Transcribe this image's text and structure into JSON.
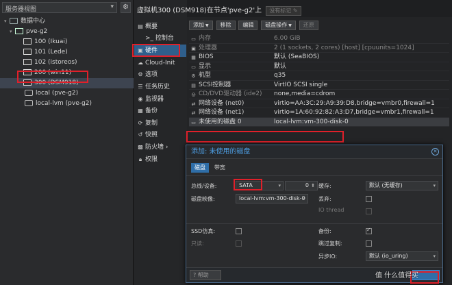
{
  "sidebar": {
    "view_label": "服务器视图",
    "tree": [
      {
        "label": "数据中心",
        "type": "datacenter"
      },
      {
        "label": "pve-g2",
        "type": "node"
      },
      {
        "label": "100 (Ikuai)",
        "type": "vm"
      },
      {
        "label": "101 (Lede)",
        "type": "vm"
      },
      {
        "label": "102 (istoreos)",
        "type": "vm"
      },
      {
        "label": "200 (win11)",
        "type": "vm"
      },
      {
        "label": "300 (DSM918)",
        "type": "vm",
        "selected": true
      },
      {
        "label": "local (pve-g2)",
        "type": "storage"
      },
      {
        "label": "local-lvm (pve-g2)",
        "type": "storage"
      }
    ]
  },
  "header": {
    "title": "虚拟机300 (DSM918)在节点'pve-g2'上",
    "tag_label": "没有标记"
  },
  "nav": {
    "items": [
      {
        "label": "概要",
        "icon": "summary-icon"
      },
      {
        "label": ">_ 控制台",
        "icon": "console-icon"
      },
      {
        "label": "硬件",
        "icon": "hardware-icon",
        "active": true
      },
      {
        "label": "Cloud-Init",
        "icon": "cloud-icon"
      },
      {
        "label": "选项",
        "icon": "options-icon"
      },
      {
        "label": "任务历史",
        "icon": "task-history-icon"
      },
      {
        "label": "监视器",
        "icon": "monitor-icon"
      },
      {
        "label": "备份",
        "icon": "backup-icon"
      },
      {
        "label": "复制",
        "icon": "replication-icon"
      },
      {
        "label": "快照",
        "icon": "snapshot-icon"
      },
      {
        "label": "防火墙",
        "icon": "firewall-icon"
      },
      {
        "label": "权限",
        "icon": "permissions-icon"
      }
    ]
  },
  "toolbar": {
    "add": "添加",
    "remove": "移除",
    "edit": "编辑",
    "disk_action": "磁盘操作",
    "revert": "还原"
  },
  "hardware": [
    {
      "name": "内存",
      "value": "6.00 GiB",
      "dim": true
    },
    {
      "name": "处理器",
      "value": "2 (1 sockets, 2 cores) [host] [cpuunits=1024]",
      "dim": true
    },
    {
      "name": "BIOS",
      "value": "默认 (SeaBIOS)"
    },
    {
      "name": "显示",
      "value": "默认"
    },
    {
      "name": "机型",
      "value": "q35"
    },
    {
      "name": "SCSI控制器",
      "value": "VirtIO SCSI single"
    },
    {
      "name": "CD/DVD驱动器 (ide2)",
      "value": "none,media=cdrom",
      "dim_name": true
    },
    {
      "name": "网络设备 (net0)",
      "value": "virtio=AA:3C:29:A9:39:D8,bridge=vmbr0,firewall=1"
    },
    {
      "name": "网络设备 (net1)",
      "value": "virtio=1A:60:92:82:A3:D7,bridge=vmbr1,firewall=1"
    },
    {
      "name": "未使用的磁盘 0",
      "value": "local-lvm:vm-300-disk-0",
      "selected": true
    }
  ],
  "dialog": {
    "title": "添加: 未使用的磁盘",
    "tabs": [
      "磁盘",
      "带宽"
    ],
    "bus_label": "总线/设备:",
    "bus_value": "SATA",
    "device_value": "0",
    "disk_image_label": "磁盘映像:",
    "disk_image_value": "local-lvm:vm-300-disk-0",
    "cache_label": "缓存:",
    "cache_value": "默认 (无缓存)",
    "discard_label": "丢弃:",
    "io_thread_label": "IO thread",
    "ssd_label": "SSD仿真:",
    "readonly_label": "只读:",
    "backup_label": "备份:",
    "skip_replication_label": "跳过复制:",
    "async_io_label": "异步IO:",
    "async_io_value": "默认 (io_uring)",
    "help_label": "帮助"
  },
  "watermark": "值 什么值得买"
}
